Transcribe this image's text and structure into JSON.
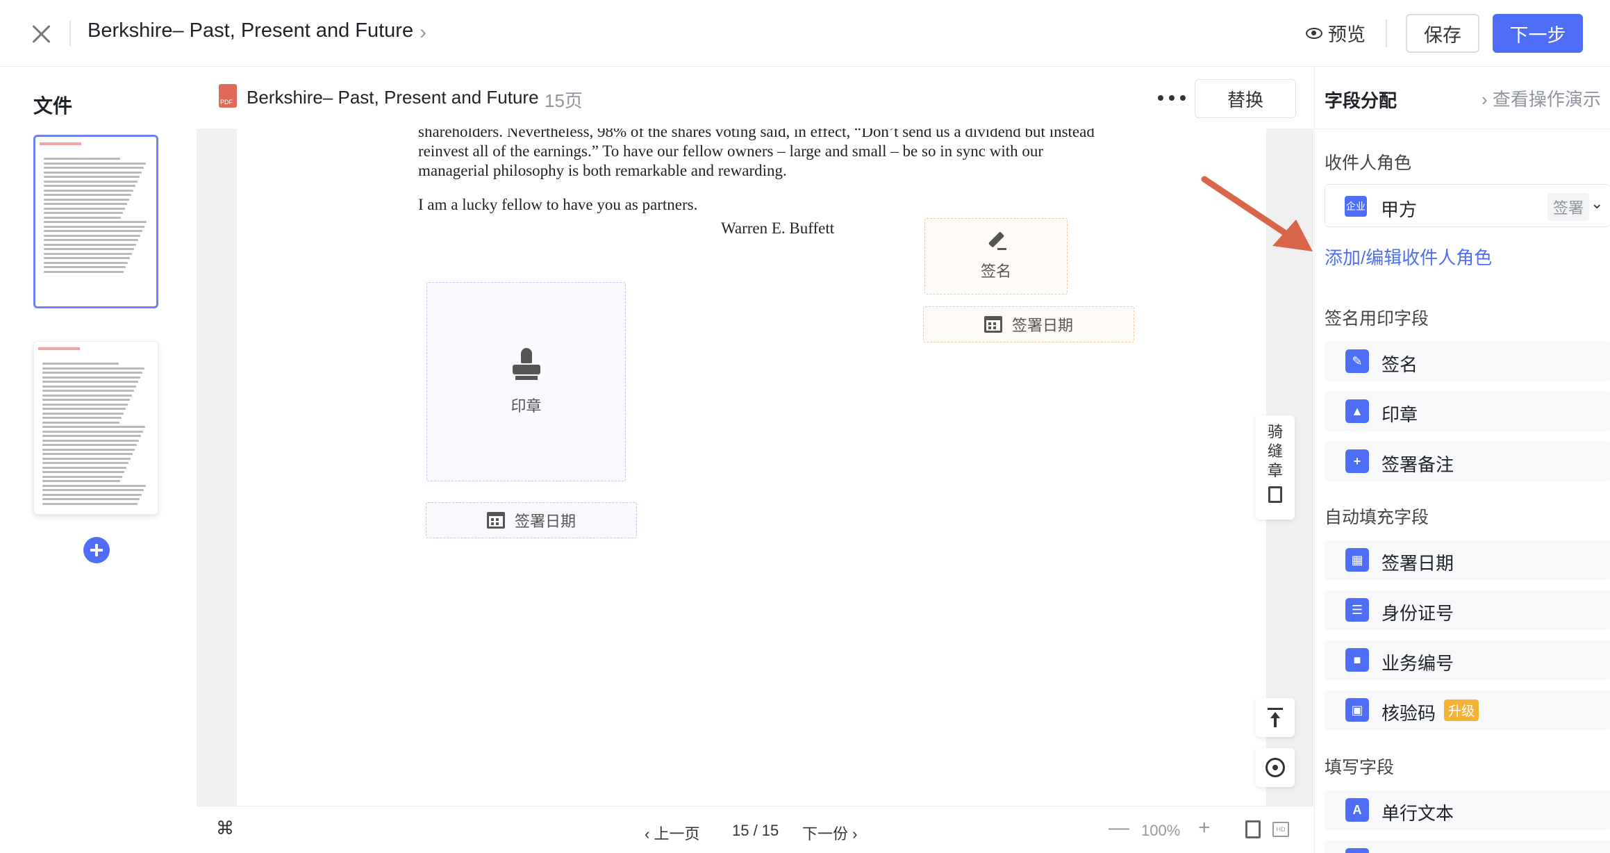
{
  "topbar": {
    "title": "Berkshire– Past, Present and Future",
    "preview_label": "预览",
    "save_label": "保存",
    "next_label": "下一步"
  },
  "sidebar": {
    "files_title": "文件"
  },
  "document": {
    "name": "Berkshire– Past, Present and Future",
    "pages_label": "15页",
    "replace_label": "替换",
    "lines": [
      "shareholders. Nevertheless, 98% of the shares voting said, in effect, “Don’t send us a dividend but instead",
      "reinvest all of the earnings.” To have our fellow owners – large and small – be so in sync with our",
      "managerial philosophy is both remarkable and rewarding.",
      "I am a lucky fellow to have you as partners."
    ],
    "signature_name": "Warren E. Buffett"
  },
  "fields": {
    "sign": "签名",
    "sign_date_1": "签署日期",
    "seal": "印章",
    "sign_date_2": "签署日期"
  },
  "tools": {
    "riding_seal_label": "骑缝章"
  },
  "bottombar": {
    "shortcut_symbol": "⌘",
    "prev_label": "上一页",
    "page_indicator": "15 / 15",
    "next_label": "下一份",
    "zoom_minus": "—",
    "zoom_level": "100%",
    "zoom_plus": "+",
    "hd_label": "HD"
  },
  "rightpanel": {
    "title": "字段分配",
    "demo_label": "查看操作演示",
    "recipient_section": "收件人角色",
    "role": {
      "tag": "企业",
      "name": "甲方",
      "action": "签署"
    },
    "add_role_link": "添加/编辑收件人角色",
    "sign_section": "签名用印字段",
    "sign_fields": [
      "签名",
      "印章",
      "签署备注"
    ],
    "auto_section": "自动填充字段",
    "auto_fields": [
      "签署日期",
      "身份证号",
      "业务编号",
      "核验码"
    ],
    "upgrade_badge": "升级",
    "fill_section": "填写字段",
    "fill_fields": [
      "单行文本"
    ],
    "fill_icon_letter": "A"
  },
  "colors": {
    "accent": "#4f6ef7",
    "annotation_arrow": "#d9664a",
    "upgrade": "#f5b335"
  }
}
